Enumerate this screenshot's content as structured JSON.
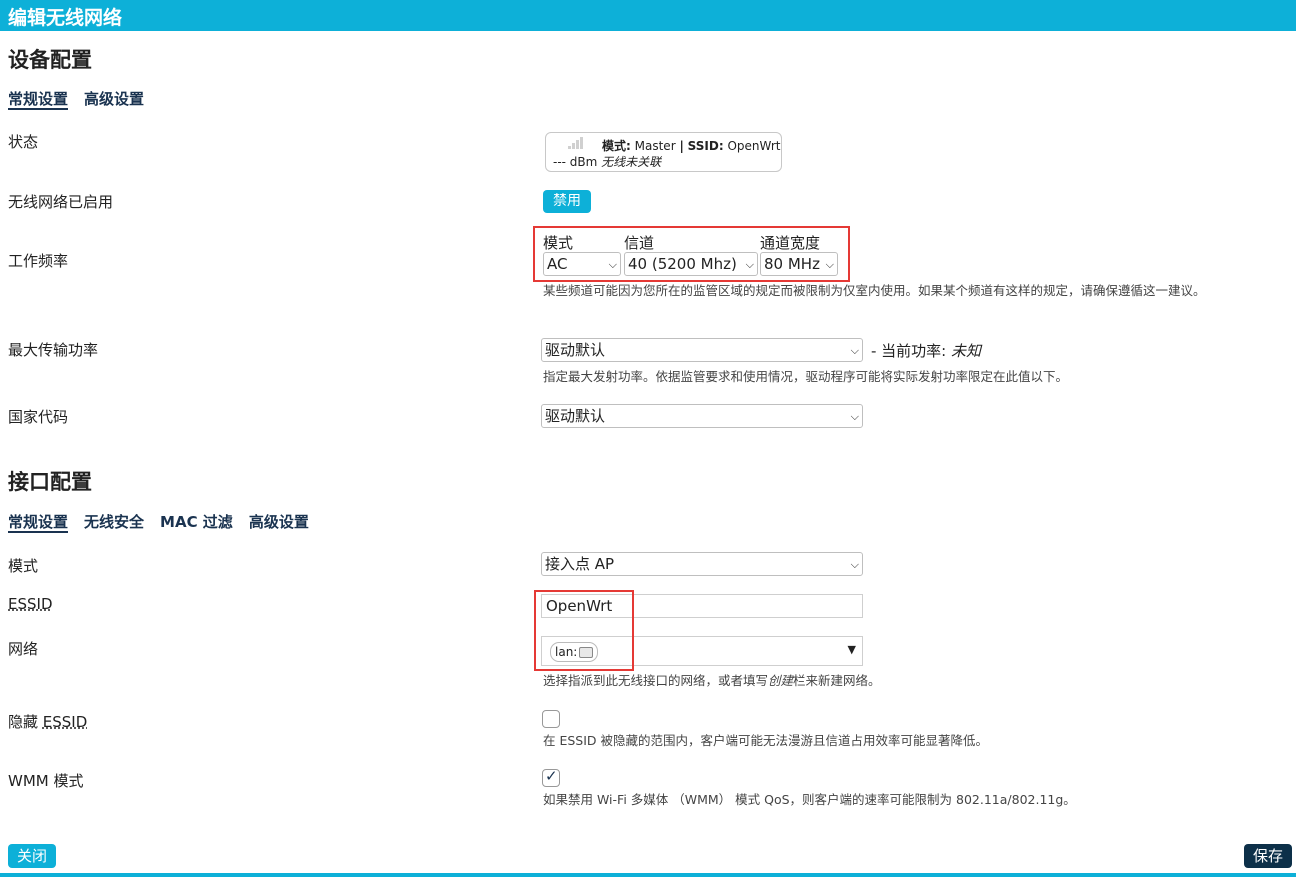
{
  "dialog": {
    "title": "编辑无线网络"
  },
  "device_config": {
    "heading": "设备配置",
    "tabs": [
      "常规设置",
      "高级设置"
    ],
    "status": {
      "label": "状态",
      "mode_label": "模式:",
      "mode_value": "Master",
      "separator": "|",
      "ssid_label": "SSID:",
      "ssid_value": "OpenWrt",
      "dbm": "--- dBm",
      "assoc": "无线未关联"
    },
    "enabled": {
      "label": "无线网络已启用",
      "button": "禁用"
    },
    "frequency": {
      "label": "工作频率",
      "mode_header": "模式",
      "channel_header": "信道",
      "width_header": "通道宽度",
      "mode_value": "AC",
      "channel_value": "40 (5200 Mhz)",
      "width_value": "80 MHz",
      "hint": "某些频道可能因为您所在的监管区域的规定而被限制为仅室内使用。如果某个频道有这样的规定，请确保遵循这一建议。"
    },
    "tx_power": {
      "label": "最大传输功率",
      "value": "驱动默认",
      "current_prefix": "- 当前功率:",
      "current_value": "未知",
      "hint": "指定最大发射功率。依据监管要求和使用情况，驱动程序可能将实际发射功率限定在此值以下。"
    },
    "country": {
      "label": "国家代码",
      "value": "驱动默认"
    }
  },
  "iface_config": {
    "heading": "接口配置",
    "tabs": [
      "常规设置",
      "无线安全",
      "MAC 过滤",
      "高级设置"
    ],
    "mode": {
      "label": "模式",
      "value": "接入点 AP"
    },
    "essid": {
      "label": "ESSID",
      "value": "OpenWrt"
    },
    "network": {
      "label": "网络",
      "chip": "lan:",
      "hint_pre": "选择指派到此无线接口的网络，或者填写",
      "hint_em": "创建",
      "hint_post": "栏来新建网络。"
    },
    "hidden": {
      "label_pre": "隐藏 ",
      "label_abbr": "ESSID",
      "checked": false,
      "hint": "在 ESSID 被隐藏的范围内，客户端可能无法漫游且信道占用效率可能显著降低。"
    },
    "wmm": {
      "label": "WMM 模式",
      "checked": true,
      "hint": "如果禁用 Wi-Fi 多媒体 （WMM） 模式 QoS，则客户端的速率可能限制为 802.11a/802.11g。"
    }
  },
  "footer": {
    "close": "关闭",
    "save": "保存"
  },
  "colors": {
    "accent": "#0db0d8",
    "save": "#0d3049",
    "highlight": "#e53935"
  }
}
